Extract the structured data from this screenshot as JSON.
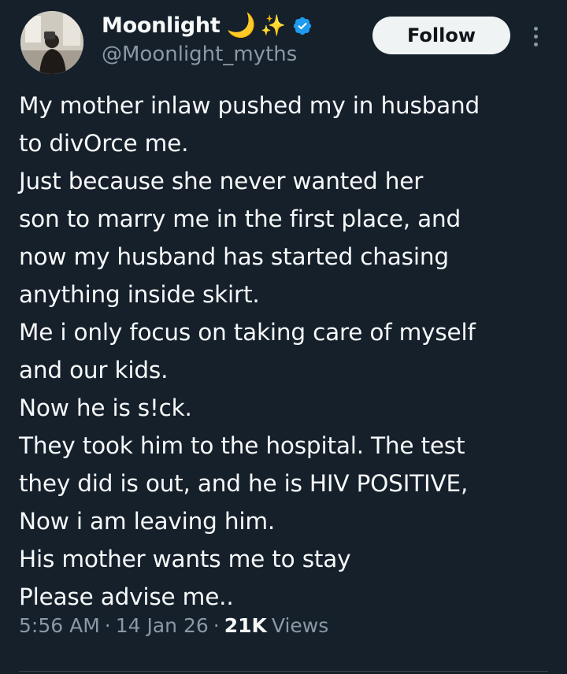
{
  "author": {
    "display_name": "Moonlight",
    "emoji_moon": "🌙",
    "emoji_sparkles": "✨",
    "verified_icon": "verified-badge-icon",
    "handle": "@Moonlight_myths",
    "avatar": "profile-photo"
  },
  "actions": {
    "follow_label": "Follow",
    "more_icon": "more-options-icon"
  },
  "tweet": {
    "lines": [
      "My mother inlaw pushed my in husband",
      "to divOrce me.",
      "Just because she never wanted her",
      "son to marry me in the first place, and",
      "now my husband has started chasing",
      "anything inside skirt.",
      "Me i only focus on taking care of myself",
      "and our kids.",
      "Now he is s!ck.",
      "They took him to the hospital. The test",
      "they did is out, and he is HIV POSITIVE,",
      "Now i am leaving him.",
      "His mother wants me to stay",
      "Please advise me.."
    ]
  },
  "meta": {
    "time": "5:56 AM",
    "separator": "·",
    "date": "14 Jan 26",
    "views_count": "21K",
    "views_label": "Views"
  },
  "colors": {
    "background": "#15202b",
    "text_primary": "#f7f9f9",
    "text_secondary": "#8b98a5",
    "verified": "#1d9bf0",
    "follow_bg": "#eff3f4"
  }
}
